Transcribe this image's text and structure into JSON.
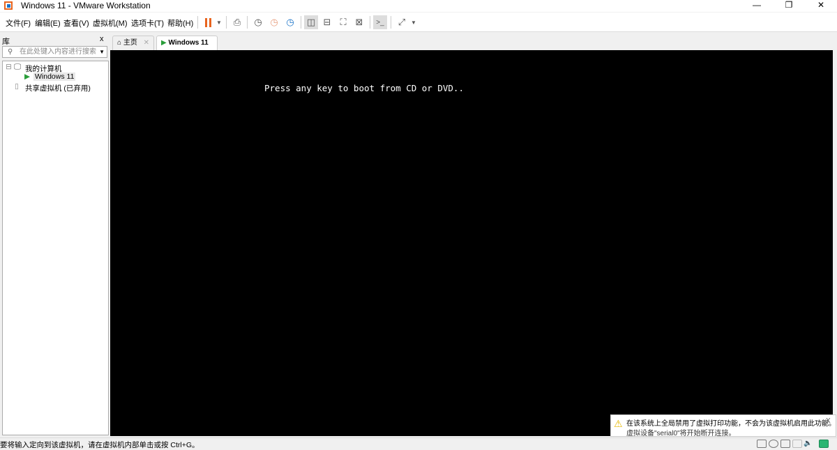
{
  "window": {
    "title": "Windows 11 - VMware Workstation",
    "minimize": "—",
    "maximize": "❐",
    "close": "✕"
  },
  "menu": [
    "文件(F)",
    "编辑(E)",
    "查看(V)",
    "虚拟机(M)",
    "选项卡(T)",
    "帮助(H)"
  ],
  "toolbar": {
    "icons": [
      "pause-icon",
      "dropdown-icon",
      "send-ctrl-alt-del-icon",
      "snapshot-icon",
      "revert-snapshot-icon",
      "snapshot-manager-icon",
      "show-library-icon",
      "thumbnail-bar-icon",
      "full-screen-icon",
      "unity-icon",
      "console-view-icon",
      "stretch-icon"
    ],
    "accent": "#e8641e"
  },
  "library": {
    "title": "库",
    "close": "x",
    "search_placeholder": "在此处键入内容进行搜索",
    "tree": {
      "root": "我的计算机",
      "vm": "Windows 11",
      "shared": "共享虚拟机 (已弃用)"
    }
  },
  "tabs": [
    {
      "label": "主页",
      "close": "✕"
    },
    {
      "label": "Windows 11",
      "close": "✕",
      "active": true
    }
  ],
  "screen": {
    "boot_text": "Press any key to boot from CD or DVD.."
  },
  "notification": {
    "line1": "在该系统上全局禁用了虚拟打印功能，不会为该虚拟机启用此功能。",
    "line2": "虚拟设备\"serial0\"将开始断开连接。",
    "close": "X"
  },
  "status": {
    "text": "要将输入定向到该虚拟机，请在虚拟机内部单击或按 Ctrl+G。",
    "device_color": "#2bb673"
  }
}
